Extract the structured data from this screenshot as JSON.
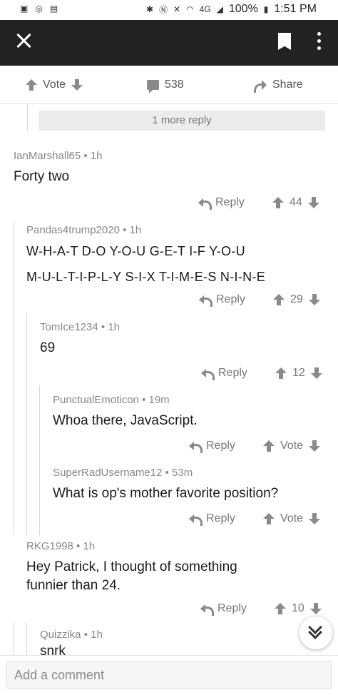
{
  "status_bar": {
    "battery": "100%",
    "time": "1:51 PM",
    "network": "4G"
  },
  "action_bar": {
    "vote_label": "Vote",
    "comment_count": "538",
    "share_label": "Share"
  },
  "more_replies": "1 more reply",
  "comments": [
    {
      "author": "IanMarshall65",
      "time": "1h",
      "lines": [
        "Forty two"
      ],
      "reply_label": "Reply",
      "score": "44"
    },
    {
      "author": "Pandas4trump2020",
      "time": "1h",
      "lines": [
        "W-H-A-T D-O Y-O-U G-E-T I-F Y-O-U",
        "M-U-L-T-I-P-L-Y S-I-X T-I-M-E-S N-I-N-E"
      ],
      "reply_label": "Reply",
      "score": "29"
    },
    {
      "author": "TomIce1234",
      "time": "1h",
      "lines": [
        "69"
      ],
      "reply_label": "Reply",
      "score": "12"
    },
    {
      "author": "PunctualEmoticon",
      "time": "19m",
      "lines": [
        "Whoa there, JavaScript."
      ],
      "reply_label": "Reply",
      "score": "Vote"
    },
    {
      "author": "SuperRadUsername12",
      "time": "53m",
      "lines": [
        "What is op's mother favorite position?"
      ],
      "reply_label": "Reply",
      "score": "Vote"
    },
    {
      "author": "RKG1998",
      "time": "1h",
      "lines": [
        "Hey Patrick, I thought of something",
        "funnier than 24."
      ],
      "reply_label": "Reply",
      "score": "10"
    },
    {
      "author": "Quizzika",
      "time": "1h",
      "lines": [
        "snrk"
      ]
    }
  ],
  "composer": {
    "placeholder": "Add a comment"
  },
  "icons": [
    "close-icon",
    "bookmark-icon",
    "more-icon",
    "upvote-icon",
    "downvote-icon",
    "comment-icon",
    "share-icon",
    "reply-icon",
    "scroll-down-icon"
  ]
}
